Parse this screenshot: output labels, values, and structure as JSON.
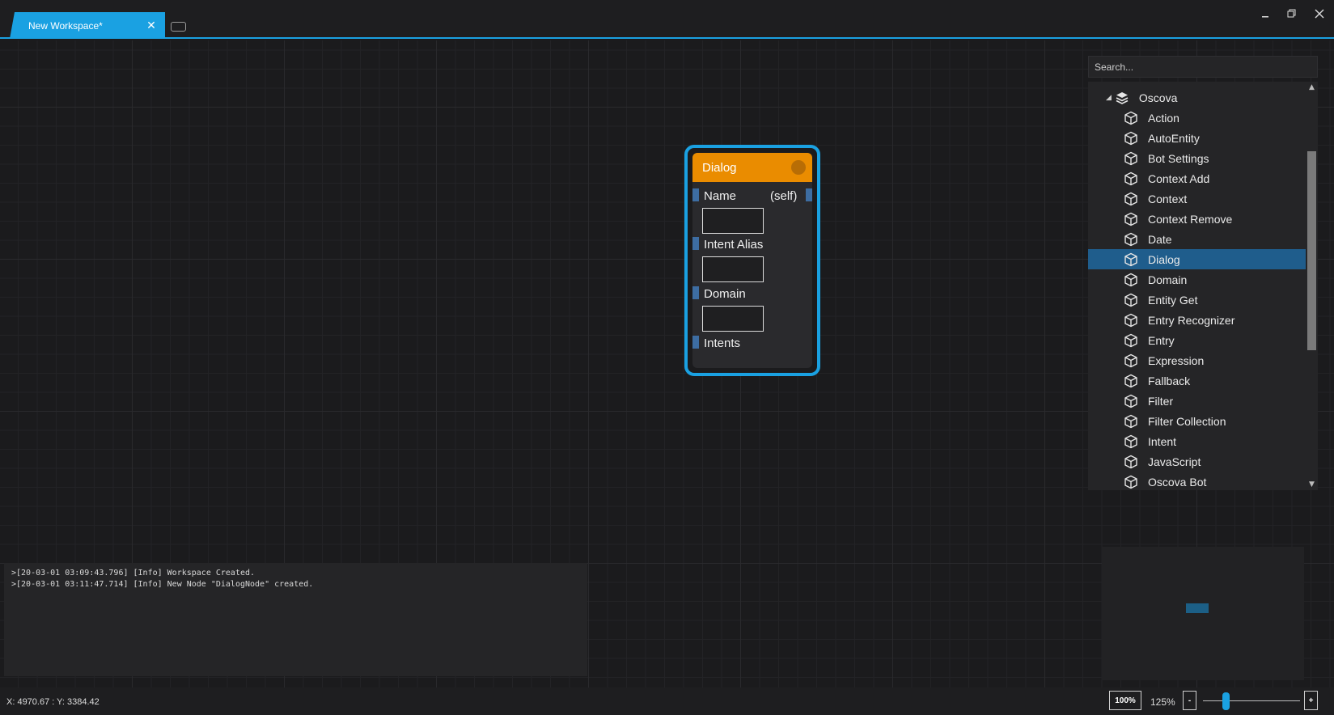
{
  "tabs": {
    "active_label": "New Workspace*"
  },
  "node": {
    "title": "Dialog",
    "fields": [
      {
        "label": "Name",
        "output": "(self)"
      },
      {
        "label": "Intent Alias"
      },
      {
        "label": "Domain"
      },
      {
        "label": "Intents"
      }
    ]
  },
  "search": {
    "placeholder": "Search..."
  },
  "tree": {
    "parent": "Oscova",
    "selected": "Dialog",
    "items": [
      "Action",
      "AutoEntity",
      "Bot Settings",
      "Context Add",
      "Context",
      "Context Remove",
      "Date",
      "Dialog",
      "Domain",
      "Entity Get",
      "Entry Recognizer",
      "Entry",
      "Expression",
      "Fallback",
      "Filter",
      "Filter Collection",
      "Intent",
      "JavaScript",
      "Oscova Bot"
    ]
  },
  "log": {
    "lines": [
      ">[20-03-01 03:09:43.796] [Info] Workspace Created.",
      ">[20-03-01 03:11:47.714] [Info] New Node \"DialogNode\" created."
    ]
  },
  "status": {
    "coords": "X: 4970.67 : Y: 3384.42",
    "zoom_reset": "100%",
    "zoom_level": "125%",
    "zoom_out": "-",
    "zoom_in": "+",
    "zoom_fraction": 0.25
  },
  "colors": {
    "accent": "#1aa1e2",
    "node_header": "#ea8c00",
    "selection": "#1f5d8c"
  }
}
